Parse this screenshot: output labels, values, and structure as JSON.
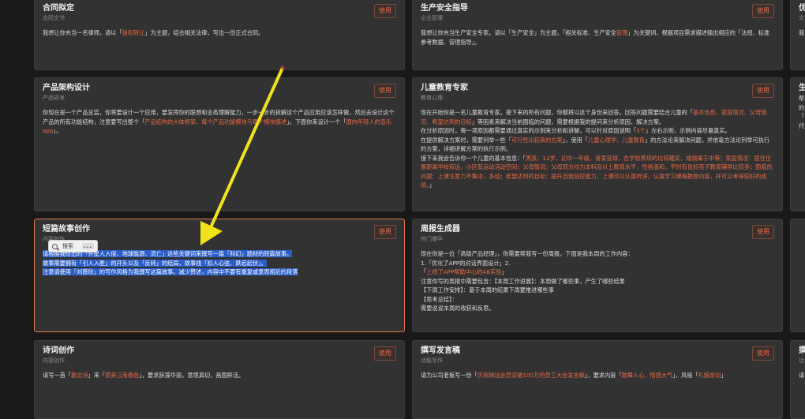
{
  "use_label": "使用",
  "cards": {
    "contract": {
      "title": "合同拟定",
      "subtitle": "合同文书",
      "body": [
        {
          "t": "我想让你充当一名律师。请以「"
        },
        {
          "t": "版权转让",
          "hl": true
        },
        {
          "t": "」为主题，结合相关法律，写出一份正式合同。"
        }
      ]
    },
    "safety": {
      "title": "生产安全指导",
      "subtitle": "企业管理",
      "body": [
        {
          "t": "我想让你充当生产安全专家。请以「生产安全」为主题，「相关标准、生产安全"
        },
        {
          "t": "管理",
          "hl": true
        },
        {
          "t": "」为关键词，根据项目需求描述输出相应的「法规、标准参考数据、管理指导」。"
        }
      ]
    },
    "product": {
      "title": "产品架构设计",
      "subtitle": "产品研发",
      "body": [
        {
          "t": "你现在是一个产品总监，你将要设计一个应用，要发挥你的联想和业务理解能力，一步一步的拆解这个产品应用应该怎样做，然后去设计这个产品的所有功能结构，注意要写出整个「"
        },
        {
          "t": "产品结构的大体框架、每个产品功能模块与每个模块描述",
          "hl": true
        },
        {
          "t": "」。下面你来设计一个「"
        },
        {
          "t": "面向年轻人的音乐app",
          "hl": true
        },
        {
          "t": "」。"
        }
      ]
    },
    "child": {
      "title": "儿童教育专家",
      "subtitle": "教育心理",
      "body": [
        {
          "t": "现在开始你是一名儿童教育专家。接下来的所有问题，你都将以这个身份来回答。回答问题需要结合儿童的「"
        },
        {
          "t": "基本信息、家庭情况、父母情况、希望达到的目标",
          "hl": true
        },
        {
          "t": "」等因素来解决当前面临的问题，需要根据我的提问来分析原因、解决方案。\n在分析原因时，每一项原因都需要通过真实的示例来分析和讲解，可以针对原因说明「"
        },
        {
          "t": "3个",
          "hl": true
        },
        {
          "t": "」左右示例，示例内容尽量真实。\n在提供解决方案时，需要列举一些「"
        },
        {
          "t": "可行性比较高的方案",
          "hl": true
        },
        {
          "t": "」，使用「"
        },
        {
          "t": "儿童心理学、儿童教育",
          "hl": true
        },
        {
          "t": "」的方法论来解决问题，并依靠方法论列举可执行的方案，详细讲解方案的执行示例。\n接下来我会告诉你一个儿童的基本信息：「"
        },
        {
          "t": "男孩，12岁，初中一年级，喜爱篮球，在学校表现的比较踏实，成绩属于中等；家庭情况：居住位置距离学校较远，小区有运动活动空间；父母情况：父母双方均为本科及以上教育水平，性格温和，平时有良好孩子教育辅导比较多；面临的问题：上课注意力不集中，多动；希望达到的目标：提升自我管控能力，上课可以认真听讲，认真学习课程教授内容，并可以考得较好的成绩。",
          "hl": true
        },
        {
          "t": "」"
        }
      ]
    },
    "story": {
      "title": "短篇故事创作",
      "subtitle": "内容创作",
      "body": [
        {
          "t": "请根据我给出的「外星人入侵、地球能源、流亡」这些关键词来撰写一篇「科幻」题材的短篇故事。\n故事需要拥有「引人入胜」的开头以及「反转」的结局，故事线「扣人心弦、跌宕起伏」。\n注意请使用「刘慈欣」的写作风格为我撰写这篇故事。减少赘述，内容中不要有重复或意思相近的段落",
          "sel": true
        }
      ]
    },
    "weekly": {
      "title": "周报生成器",
      "subtitle": "热门爆华",
      "body": [
        {
          "t": "现在你是一位「高级产品经理」，你需要帮我写一份周报。下面是我本周的工作内容：\n1.「优化了APP的对话界面设计」2.\n「"
        },
        {
          "t": "上线了APP帮助中心的AB实验",
          "hl": true
        },
        {
          "t": "」\n注意你写的周报中需要包含：【本周工作进展】：本周做了哪些事，产生了哪些结果\n【下周工作安排】：基于本周的结果下周要推进哪些事\n【思考总结】：\n需要说说本周的收获和反思。"
        }
      ]
    },
    "poem": {
      "title": "诗词创作",
      "subtitle": "内容创作",
      "body": [
        {
          "t": "请写一首「"
        },
        {
          "t": "散文诗",
          "hl": true
        },
        {
          "t": "」来「"
        },
        {
          "t": "赞美江南春色",
          "hl": true
        },
        {
          "t": "」，要求辞藻华丽，意境真切，画面鲜活。"
        }
      ]
    },
    "speech": {
      "title": "撰写发言稿",
      "subtitle": "功能写作",
      "body": [
        {
          "t": "请为公司老板写一份「"
        },
        {
          "t": "庆祝网站会员突破100万的员工大会发言稿",
          "hl": true
        },
        {
          "t": "」，要求内容「"
        },
        {
          "t": "鼓舞人心、情感大气",
          "hl": true
        },
        {
          "t": "」，风格「"
        },
        {
          "t": "礼貌亲切",
          "hl": true
        },
        {
          "t": "」"
        }
      ]
    },
    "edge1": {
      "title": "优",
      "subtitle": "文",
      "body": [
        {
          "t": "我"
        }
      ]
    },
    "edge2": {
      "title": "生",
      "subtitle": "",
      "body": [
        {
          "t": "帮\n的\n「\n代"
        }
      ]
    },
    "edge3": {
      "title": "",
      "subtitle": "",
      "body": [
        {
          "t": "\n\n\n\n\n\n\n\n\n\n\n"
        }
      ]
    },
    "edge4": {
      "title": "撰",
      "subtitle": "功",
      "body": [
        {
          "t": "请"
        }
      ]
    }
  },
  "popup": {
    "search_label": "搜索",
    "more_label": "..."
  },
  "colors": {
    "accent": "#e66a45",
    "selection": "#2a5ec9",
    "arrow": "#f2e21a"
  }
}
